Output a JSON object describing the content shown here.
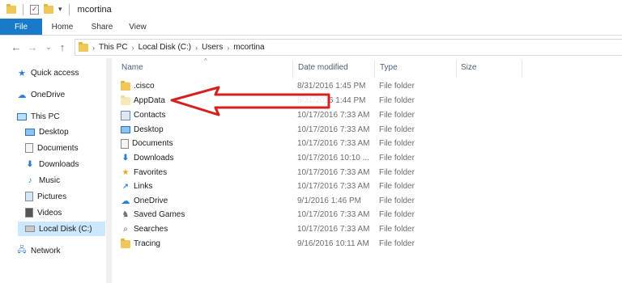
{
  "window": {
    "title": "mcortina"
  },
  "ribbon": {
    "tabs": [
      "File",
      "Home",
      "Share",
      "View"
    ]
  },
  "address": {
    "crumbs": [
      "This PC",
      "Local Disk (C:)",
      "Users",
      "mcortina"
    ]
  },
  "nav": {
    "quick_access": "Quick access",
    "onedrive": "OneDrive",
    "this_pc": "This PC",
    "desktop": "Desktop",
    "documents": "Documents",
    "downloads": "Downloads",
    "music": "Music",
    "pictures": "Pictures",
    "videos": "Videos",
    "local_disk": "Local Disk (C:)",
    "network": "Network"
  },
  "columns": {
    "name": "Name",
    "date": "Date modified",
    "type": "Type",
    "size": "Size"
  },
  "rows": [
    {
      "name": ".cisco",
      "date": "8/31/2016 1:45 PM",
      "type": "File folder",
      "icon": "folder-icon"
    },
    {
      "name": "AppData",
      "date": "8/31/2016 1:44 PM",
      "type": "File folder",
      "icon": "folder-icon"
    },
    {
      "name": "Contacts",
      "date": "10/17/2016 7:33 AM",
      "type": "File folder",
      "icon": "contacts-icon"
    },
    {
      "name": "Desktop",
      "date": "10/17/2016 7:33 AM",
      "type": "File folder",
      "icon": "desktop-icon"
    },
    {
      "name": "Documents",
      "date": "10/17/2016 7:33 AM",
      "type": "File folder",
      "icon": "documents-icon"
    },
    {
      "name": "Downloads",
      "date": "10/17/2016 10:10 ...",
      "type": "File folder",
      "icon": "downloads-icon"
    },
    {
      "name": "Favorites",
      "date": "10/17/2016 7:33 AM",
      "type": "File folder",
      "icon": "favorites-icon"
    },
    {
      "name": "Links",
      "date": "10/17/2016 7:33 AM",
      "type": "File folder",
      "icon": "links-icon"
    },
    {
      "name": "OneDrive",
      "date": "9/1/2016 1:46 PM",
      "type": "File folder",
      "icon": "onedrive-icon"
    },
    {
      "name": "Saved Games",
      "date": "10/17/2016 7:33 AM",
      "type": "File folder",
      "icon": "saved-games-icon"
    },
    {
      "name": "Searches",
      "date": "10/17/2016 7:33 AM",
      "type": "File folder",
      "icon": "searches-icon"
    },
    {
      "name": "Tracing",
      "date": "9/16/2016 10:11 AM",
      "type": "File folder",
      "icon": "folder-icon"
    }
  ],
  "colors": {
    "file_tab": "#1979ca",
    "selected": "#cce8ff",
    "annotation_arrow": "#d62020"
  }
}
